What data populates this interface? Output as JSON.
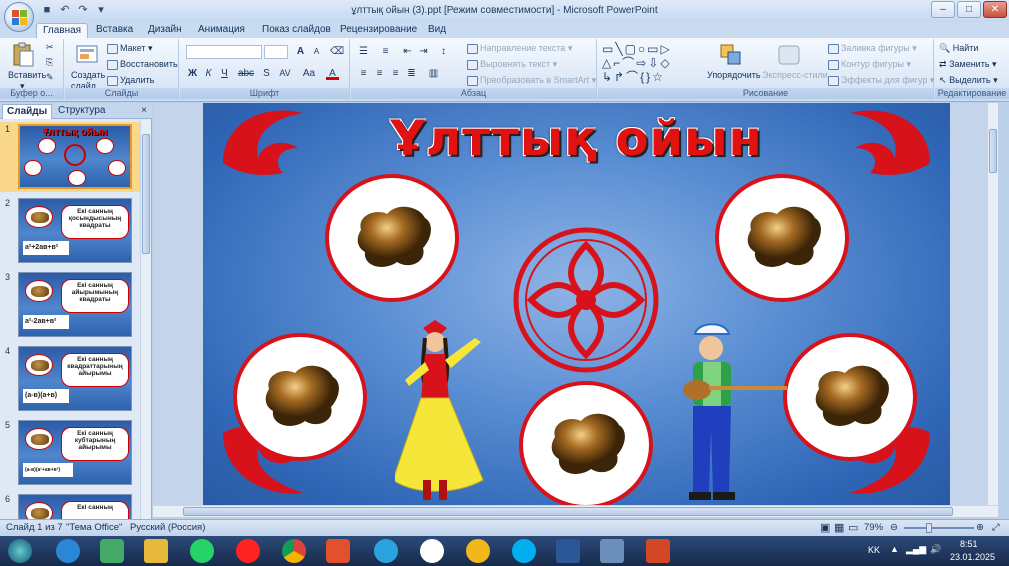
{
  "window": {
    "title": "ұлттық ойын (3).ppt [Режим совместимости] - Microsoft PowerPoint",
    "controls": [
      "–",
      "□",
      "✕"
    ]
  },
  "ribbon_tabs": [
    "Главная",
    "Вставка",
    "Дизайн",
    "Анимация",
    "Показ слайдов",
    "Рецензирование",
    "Вид"
  ],
  "active_tab": "Главная",
  "ribbon": {
    "clipboard": {
      "paste": "Вставить",
      "label": "Буфер о..."
    },
    "slides": {
      "new_slide_1": "Создать",
      "new_slide_2": "слайд",
      "layout": "Макет",
      "reset": "Восстановить",
      "delete": "Удалить",
      "label": "Слайды"
    },
    "font": {
      "label": "Шрифт",
      "bold": "Ж",
      "italic": "К",
      "underline": "Ч",
      "strike": "abc",
      "shadow": "S",
      "spacing": "AV",
      "case": "Aa",
      "color": "A",
      "grow": "A",
      "shrink": "A"
    },
    "paragraph": {
      "text_direction": "Направление текста",
      "align_text": "Выровнять текст",
      "smartart": "Преобразовать в SmartArt",
      "label": "Абзац"
    },
    "drawing": {
      "arrange": "Упорядочить",
      "quick_styles": "Экспресс-стили",
      "shape_fill": "Заливка фигуры",
      "shape_outline": "Контур фигуры",
      "shape_effects": "Эффекты для фигур",
      "label": "Рисование"
    },
    "editing": {
      "find": "Найти",
      "replace": "Заменить",
      "select": "Выделить",
      "label": "Редактирование"
    }
  },
  "side_panel": {
    "tab_slides": "Слайды",
    "tab_outline": "Структура",
    "close": "×",
    "thumbnails": [
      {
        "num": "1",
        "title": "Ұлттық ойын"
      },
      {
        "num": "2",
        "text": "Екі санның қосындысының квадраты",
        "formula": "a²+2ав+в²"
      },
      {
        "num": "3",
        "text": "Екі санның айырымының квадраты",
        "formula": "a²-2ав+в²"
      },
      {
        "num": "4",
        "text": "Екі санның квадраттарының айырымы",
        "formula": "(а-в)(а+в)"
      },
      {
        "num": "5",
        "text": "Екі санның кубтарының айырымы",
        "formula": "(а-в)(а²+ав+в²)"
      },
      {
        "num": "6",
        "text": "Екі санның"
      }
    ]
  },
  "slide": {
    "title": "Ұлттық ойын"
  },
  "status": {
    "slide_info": "Слайд 1 из 7",
    "theme": "\"Тема Office\"",
    "language": "Русский (Россия)",
    "zoom": "79%"
  },
  "taskbar": {
    "lang": "KK",
    "time": "8:51",
    "date": "23.01.2025"
  },
  "colors": {
    "accent": "#d8121a",
    "slide_bg": "#4f86cc",
    "title_red": "#e01212"
  }
}
